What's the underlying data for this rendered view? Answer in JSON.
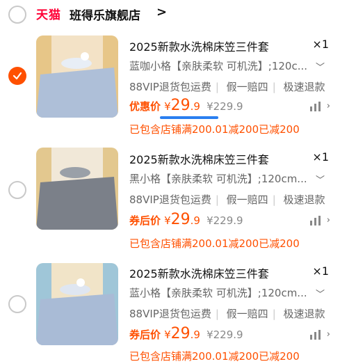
{
  "store": {
    "logo_text": "天猫",
    "name": "班得乐旗舰店",
    "chevron": ">"
  },
  "items": [
    {
      "title": "2025新款水洗棉床笠三件套",
      "qty": "×1",
      "sku": "蓝咖小格【亲肤柔软 可机洗】;120c...",
      "services": [
        "88VIP退货包运费",
        "假一赔四",
        "极速退款"
      ],
      "price_label": "优惠价",
      "price_currency": "¥",
      "price_int": "29",
      "price_dec": ".9",
      "price_original": "¥229.9",
      "promo": "已包含店铺满200.01减200已减200",
      "selected": true,
      "image_colors": {
        "sheet": "#aebfd8",
        "wall": "#f3e2c6",
        "side": "#e7c688"
      }
    },
    {
      "title": "2025新款水洗棉床笠三件套",
      "qty": "×1",
      "sku": "黑小格【亲肤柔软 可机洗】;120cm...",
      "services": [
        "88VIP退货包运费",
        "假一赔四",
        "极速退款"
      ],
      "price_label": "券后价",
      "price_currency": "¥",
      "price_int": "29",
      "price_dec": ".9",
      "price_original": "¥229.9",
      "promo": "已包含店铺满200.01减200已减200",
      "selected": false,
      "image_colors": {
        "sheet": "#7b8089",
        "wall": "#f1e8d8",
        "side": "#e3c88f"
      }
    },
    {
      "title": "2025新款水洗棉床笠三件套",
      "qty": "×1",
      "sku": "蓝小格【亲肤柔软 可机洗】;120cm...",
      "services": [
        "88VIP退货包运费",
        "假一赔四",
        "极速退款"
      ],
      "price_label": "券后价",
      "price_currency": "¥",
      "price_int": "29",
      "price_dec": ".9",
      "price_original": "¥229.9",
      "promo": "已包含店铺满200.01减200已减200",
      "selected": false,
      "image_colors": {
        "sheet": "#a9bbd6",
        "wall": "#f1e4c8",
        "side": "#9fc6d8"
      }
    }
  ],
  "colors": {
    "accent": "#ff5000",
    "tmall": "#ff0036",
    "highlight": "#2a7ff0"
  }
}
